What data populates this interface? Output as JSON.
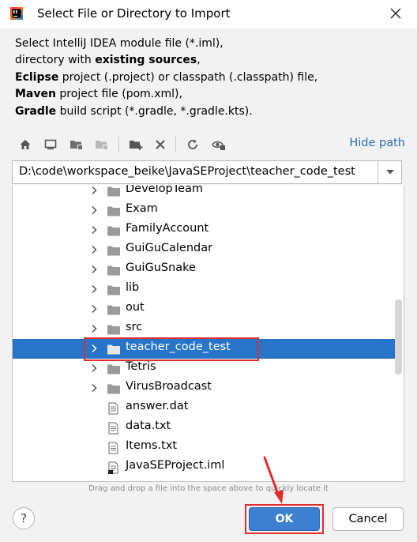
{
  "window": {
    "title": "Select File or Directory to Import",
    "app_icon": "intellij-idea-icon",
    "close_icon": "close-icon"
  },
  "description": {
    "line1": "Select IntelliJ IDEA module file (*.iml),",
    "line2_pre": "directory with ",
    "line2_bold": "existing sources",
    "line2_post": ",",
    "line3_bold": "Eclipse",
    "line3_post": " project (.project) or classpath (.classpath) file,",
    "line4_bold": "Maven",
    "line4_post": " project file (pom.xml),",
    "line5_bold": "Gradle",
    "line5_post": " build script (*.gradle, *.gradle.kts)."
  },
  "toolbar": {
    "buttons": [
      "home-icon",
      "desktop-icon",
      "project-folder-icon",
      "module-folder-icon",
      "new-folder-icon",
      "delete-icon",
      "refresh-icon",
      "show-hidden-icon"
    ],
    "hide_path_label": "Hide path"
  },
  "path": {
    "value": "D:\\code\\workspace_beike\\JavaSEProject\\teacher_code_test"
  },
  "tree": {
    "items": [
      {
        "label": "DevelopTeam",
        "type": "folder",
        "expandable": true,
        "selected": false
      },
      {
        "label": "Exam",
        "type": "folder",
        "expandable": true,
        "selected": false
      },
      {
        "label": "FamilyAccount",
        "type": "folder",
        "expandable": true,
        "selected": false
      },
      {
        "label": "GuiGuCalendar",
        "type": "folder",
        "expandable": true,
        "selected": false
      },
      {
        "label": "GuiGuSnake",
        "type": "folder",
        "expandable": true,
        "selected": false
      },
      {
        "label": "lib",
        "type": "folder",
        "expandable": true,
        "selected": false
      },
      {
        "label": "out",
        "type": "folder",
        "expandable": true,
        "selected": false
      },
      {
        "label": "src",
        "type": "folder",
        "expandable": true,
        "selected": false
      },
      {
        "label": "teacher_code_test",
        "type": "folder",
        "expandable": true,
        "selected": true
      },
      {
        "label": "Tetris",
        "type": "folder",
        "expandable": true,
        "selected": false
      },
      {
        "label": "VirusBroadcast",
        "type": "folder",
        "expandable": true,
        "selected": false
      },
      {
        "label": "answer.dat",
        "type": "file",
        "expandable": false,
        "selected": false
      },
      {
        "label": "data.txt",
        "type": "file",
        "expandable": false,
        "selected": false
      },
      {
        "label": "Items.txt",
        "type": "file",
        "expandable": false,
        "selected": false
      },
      {
        "label": "JavaSEProject.iml",
        "type": "iml",
        "expandable": false,
        "selected": false
      }
    ]
  },
  "hint": "Drag and drop a file into the space above to quickly locate it",
  "buttons": {
    "help": "?",
    "ok": "OK",
    "cancel": "Cancel"
  },
  "colors": {
    "selection": "#2675c8",
    "link": "#2470b3",
    "annotation_red": "#e02d2d",
    "ok_button": "#3d7fd1"
  }
}
